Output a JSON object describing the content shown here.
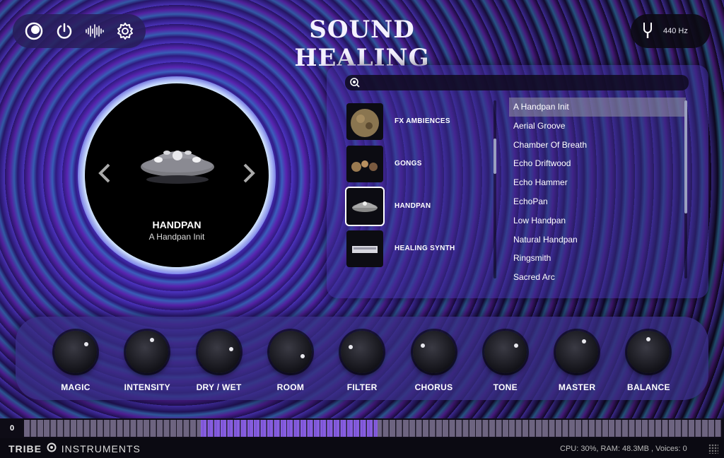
{
  "header": {
    "title": "SOUND HEALING",
    "toolbar_icons": [
      "theme-icon",
      "power-icon",
      "waveform-icon",
      "gear-icon"
    ],
    "tuner": {
      "icon": "tuning-fork-icon",
      "value": "440 Hz"
    }
  },
  "instrument": {
    "name": "HANDPAN",
    "preset": "A Handpan Init",
    "prev_icon": "chevron-left-icon",
    "next_icon": "chevron-right-icon"
  },
  "browser": {
    "search_placeholder": "",
    "categories": [
      {
        "label": "FX AMBIENCES"
      },
      {
        "label": "GONGS"
      },
      {
        "label": "HANDPAN"
      },
      {
        "label": "HEALING SYNTH"
      }
    ],
    "presets": [
      "A Handpan Init",
      "Aerial Groove",
      "Chamber Of Breath",
      "Echo Driftwood",
      "Echo Hammer",
      "EchoPan",
      "Low Handpan",
      "Natural Handpan",
      "Ringsmith",
      "Sacred Arc"
    ],
    "selected_preset": "A Handpan Init"
  },
  "knobs": [
    {
      "label": "MAGIC",
      "level": 0.7
    },
    {
      "label": "INTENSITY",
      "level": 0.58
    },
    {
      "label": "DRY / WET",
      "level": 0.78
    },
    {
      "label": "ROOM",
      "level": 0.9
    },
    {
      "label": "FILTER",
      "level": 0.25
    },
    {
      "label": "CHORUS",
      "level": 0.28
    },
    {
      "label": "TONE",
      "level": 0.72
    },
    {
      "label": "MASTER",
      "level": 0.62
    },
    {
      "label": "BALANCE",
      "level": 0.5
    }
  ],
  "keyboard": {
    "octave": "0"
  },
  "footer": {
    "brand_left": "TRIBE",
    "brand_right": "INSTRUMENTS",
    "status": "CPU: 30%, RAM: 48.3MB , Voices: 0"
  }
}
